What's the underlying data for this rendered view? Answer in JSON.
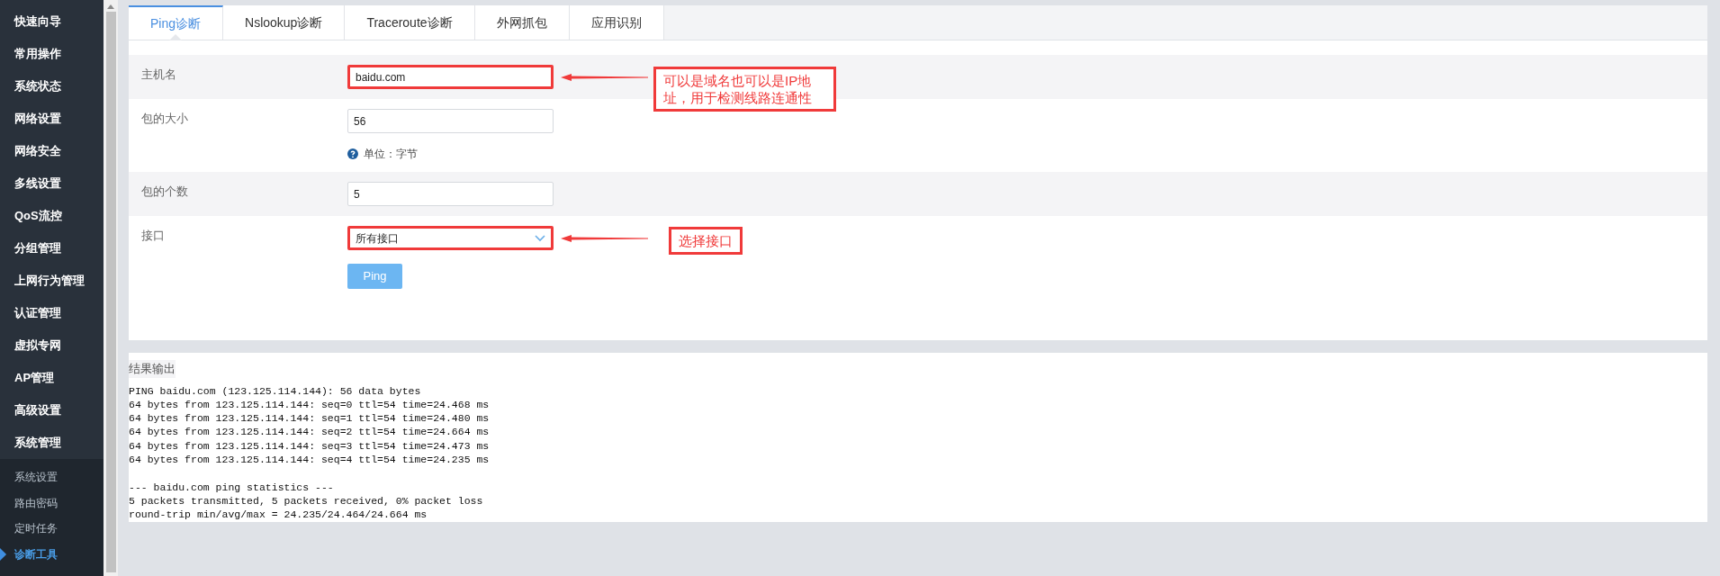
{
  "sidebar": {
    "items": [
      {
        "label": "快速向导",
        "selected": false
      },
      {
        "label": "常用操作",
        "selected": false
      },
      {
        "label": "系统状态",
        "selected": false
      },
      {
        "label": "网络设置",
        "selected": false
      },
      {
        "label": "网络安全",
        "selected": false
      },
      {
        "label": "多线设置",
        "selected": false
      },
      {
        "label": "QoS流控",
        "selected": false
      },
      {
        "label": "分组管理",
        "selected": false
      },
      {
        "label": "上网行为管理",
        "selected": false
      },
      {
        "label": "认证管理",
        "selected": false
      },
      {
        "label": "虚拟专网",
        "selected": false
      },
      {
        "label": "AP管理",
        "selected": false
      },
      {
        "label": "高级设置",
        "selected": false
      },
      {
        "label": "系统管理",
        "selected": false,
        "expanded": true,
        "children": [
          {
            "label": "系统设置",
            "selected": false
          },
          {
            "label": "路由密码",
            "selected": false
          },
          {
            "label": "定时任务",
            "selected": false
          },
          {
            "label": "诊断工具",
            "selected": true
          }
        ]
      }
    ]
  },
  "tabs": [
    {
      "label": "Ping诊断",
      "selected": true
    },
    {
      "label": "Nslookup诊断",
      "selected": false
    },
    {
      "label": "Traceroute诊断",
      "selected": false
    },
    {
      "label": "外网抓包",
      "selected": false
    },
    {
      "label": "应用识别",
      "selected": false
    }
  ],
  "form": {
    "fields": [
      {
        "label": "主机名",
        "kind": "text",
        "value": "baidu.com",
        "highlighted": true,
        "annotation": "可以是域名也可以是IP地址，用于检测线路连通性"
      },
      {
        "label": "包的大小",
        "kind": "text",
        "value": "56",
        "help": "单位：字节",
        "highlighted": false
      },
      {
        "label": "包的个数",
        "kind": "text",
        "value": "5",
        "highlighted": false
      },
      {
        "label": "接口",
        "kind": "select",
        "value": "所有接口",
        "highlighted": true,
        "annotation": "选择接口"
      }
    ],
    "button": "Ping"
  },
  "result": {
    "title": "结果输出",
    "lines": [
      "PING baidu.com (123.125.114.144): 56 data bytes",
      "64 bytes from 123.125.114.144: seq=0 ttl=54 time=24.468 ms",
      "64 bytes from 123.125.114.144: seq=1 ttl=54 time=24.480 ms",
      "64 bytes from 123.125.114.144: seq=2 ttl=54 time=24.664 ms",
      "64 bytes from 123.125.114.144: seq=3 ttl=54 time=24.473 ms",
      "64 bytes from 123.125.114.144: seq=4 ttl=54 time=24.235 ms"
    ],
    "summary": [
      "--- baidu.com ping statistics ---",
      "5 packets transmitted, 5 packets received, 0% packet loss",
      "round-trip min/avg/max = 24.235/24.464/24.664 ms"
    ]
  }
}
